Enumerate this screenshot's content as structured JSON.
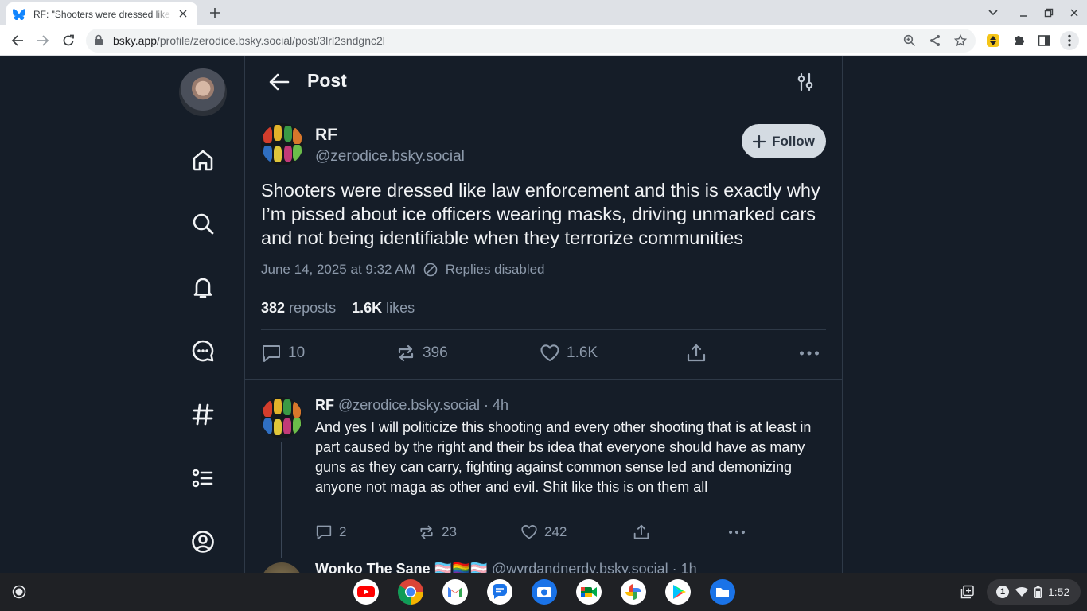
{
  "browser": {
    "tab_title": "RF: \"Shooters were dressed like law enforcement",
    "url_host": "bsky.app",
    "url_path": "/profile/zerodice.bsky.social/post/3lrl2sndgnc2l"
  },
  "header": {
    "title": "Post"
  },
  "post": {
    "display_name": "RF",
    "handle": "@zerodice.bsky.social",
    "follow_label": "Follow",
    "text": "Shooters were dressed like law enforcement and this is exactly why I’m pissed about ice officers wearing masks, driving unmarked cars and not being identifiable when they terrorize communities",
    "timestamp": "June 14, 2025 at 9:32 AM",
    "replies_status": "Replies disabled",
    "reposts_count": "382",
    "reposts_label": "reposts",
    "likes_count": "1.6K",
    "likes_label": "likes",
    "actions": {
      "replies": "10",
      "reposts": "396",
      "likes": "1.6K"
    }
  },
  "reply": {
    "display_name": "RF",
    "handle": "@zerodice.bsky.social",
    "time": "· 4h",
    "text": "And yes I will politicize this shooting and every other shooting that is at least in part caused by the right and their bs idea that everyone should have as many guns as they can carry, fighting against common sense led and demonizing anyone not maga as other and evil. Shit like this is on them all",
    "actions": {
      "replies": "2",
      "reposts": "23",
      "likes": "242"
    }
  },
  "next_reply": {
    "display_name": "Wonko The Sane 🏳️‍⚧️🏳️‍🌈🏳️‍⚧️",
    "handle": "@wyrdandnerdy.bsky.social",
    "time": "· 1h"
  },
  "shelf": {
    "notification_count": "1",
    "clock": "1:52"
  },
  "colors": {
    "background": "#151d28",
    "text": "#f1f3f5",
    "muted": "#8d9aab",
    "border": "#2e3947",
    "follow_bg": "#d4dbe2"
  },
  "icons": {
    "nav": [
      "home-icon",
      "search-icon",
      "bell-icon",
      "chat-icon",
      "hashtag-icon",
      "list-icon",
      "profile-icon"
    ],
    "shelf_apps": [
      "youtube-icon",
      "chrome-icon",
      "gmail-icon",
      "messages-icon",
      "camera-icon",
      "meet-icon",
      "photos-icon",
      "play-store-icon",
      "files-icon"
    ]
  }
}
